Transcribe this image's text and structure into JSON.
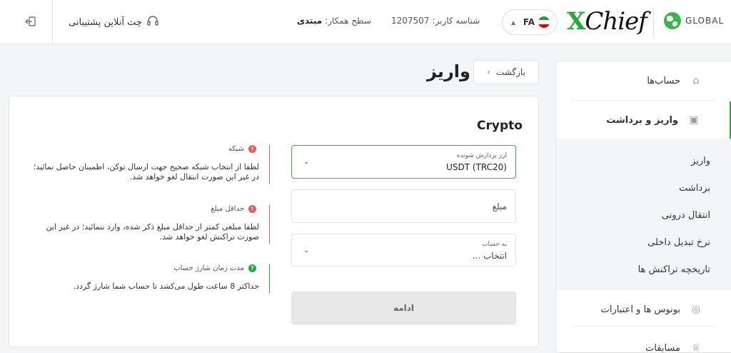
{
  "header": {
    "support_label": "چت آنلاین پشتیبانی",
    "level_label": "سطح همکار:",
    "level_value": "مبتدی",
    "userid_label": "شناسه کاربر:",
    "userid_value": "1207507",
    "lang_code": "FA",
    "logo_text": "XChief",
    "global_label": "GLOBAL"
  },
  "sidebar": {
    "accounts": "حساب‌ها",
    "deposit_withdraw": "واریز و برداشت",
    "sub_items": [
      "واریز",
      "برداشت",
      "انتقال درونی",
      "نرخ تبدیل داخلی",
      "تاریخچه تراکنش ها"
    ],
    "bonuses": "بونوس ها و اعتبارات",
    "contests": "مسابقات"
  },
  "main": {
    "title": "واریز",
    "back_label": "بازگشت",
    "section_title": "Crypto",
    "currency_label": "ارز پردازش شونده",
    "currency_value": "USDT (TRC20)",
    "amount_placeholder": "مبلغ",
    "account_label": "به حساب",
    "account_value": "انتخاب ...",
    "submit_label": "ادامه"
  },
  "notes": [
    {
      "title": "شبکه",
      "text": "لطفا از انتخاب شبکه صحیح جهت ارسال توکن، اطمینان حاصل نمائید؛ در غیر این صورت انتقال لغو خواهد شد.",
      "status": "error"
    },
    {
      "title": "حداقل مبلغ",
      "text": "لطفا مبلغی کمتر از حداقل مبلغ ذکر شده، وارد ننمائید؛ در غیر این صورت تراکنش لغو خواهد شد.",
      "status": "error"
    },
    {
      "title": "مدت زمان شارژ حساب",
      "text": "حداکثر 8 ساعت طول می‌کشد تا حساب شما شارژ گردد.",
      "status": "info"
    }
  ],
  "colors": {
    "accent": "#2aa83c",
    "error": "#e45b5b",
    "info": "#2aa83c"
  },
  "icons": {
    "logout": "logout-icon",
    "support": "headset-icon",
    "lang_dropdown": "chevron-down-icon",
    "globe": "globe-icon"
  }
}
